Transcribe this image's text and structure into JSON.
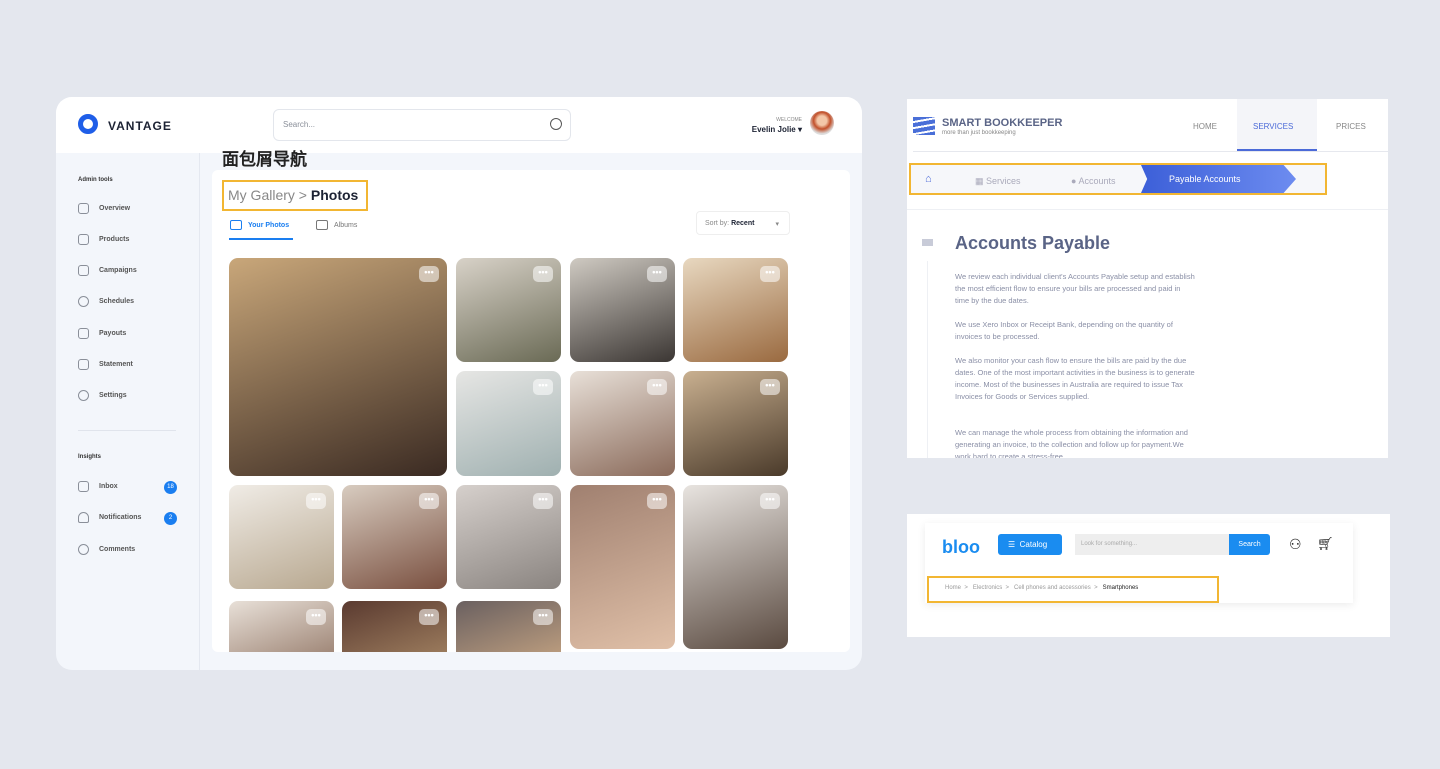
{
  "vantage": {
    "brand": "VANTAGE",
    "search_placeholder": "Search...",
    "welcome": "WELCOME",
    "user": "Evelin Jolie ▾",
    "annotation": "面包屑导航",
    "sidebar": {
      "section1": "Admin tools",
      "items": [
        "Overview",
        "Products",
        "Campaigns",
        "Schedules",
        "Payouts",
        "Statement",
        "Settings"
      ],
      "section2": "Insights",
      "insights": [
        {
          "label": "Inbox",
          "badge": "18"
        },
        {
          "label": "Notifications",
          "badge": "2"
        },
        {
          "label": "Comments"
        }
      ]
    },
    "breadcrumb": {
      "parent": "My Gallery",
      "sep": " > ",
      "current": "Photos"
    },
    "tabs": [
      "Your Photos",
      "Albums"
    ],
    "sort": {
      "label": "Sort by:",
      "value": "Recent"
    },
    "photo_menu": "•••",
    "accent": "#1a7ef0"
  },
  "bookkeeper": {
    "name": "SMART BOOKKEEPER",
    "tagline": "more than just bookkeeping",
    "nav": [
      "HOME",
      "SERVICES",
      "PRICES"
    ],
    "active_nav": "SERVICES",
    "breadcrumb": [
      "Services",
      "Accounts",
      "Payable Accounts"
    ],
    "title": "Accounts Payable",
    "paragraphs": [
      "We review each individual client's Accounts Payable setup and establish the most efficient flow to ensure your bills are processed and paid in time by the due dates.",
      "We use Xero Inbox or Receipt Bank, depending on the quantity of invoices to be processed.",
      "We also monitor your cash flow to ensure the bills are paid by the due dates. One of the most important activities in the business is to generate income. Most of the businesses in Australia are required to issue Tax Invoices for Goods or Services supplied.",
      "We can manage the whole process from obtaining the information and generating an invoice, to the collection and follow up for payment.We work hard to create a stress-free"
    ]
  },
  "bloo": {
    "brand": "bloo",
    "catalog": "Catalog",
    "search_placeholder": "Look for something...",
    "search_button": "Search",
    "breadcrumb": [
      "Home",
      "Electronics",
      "Cell phones and accessories",
      "Smartphones"
    ]
  }
}
